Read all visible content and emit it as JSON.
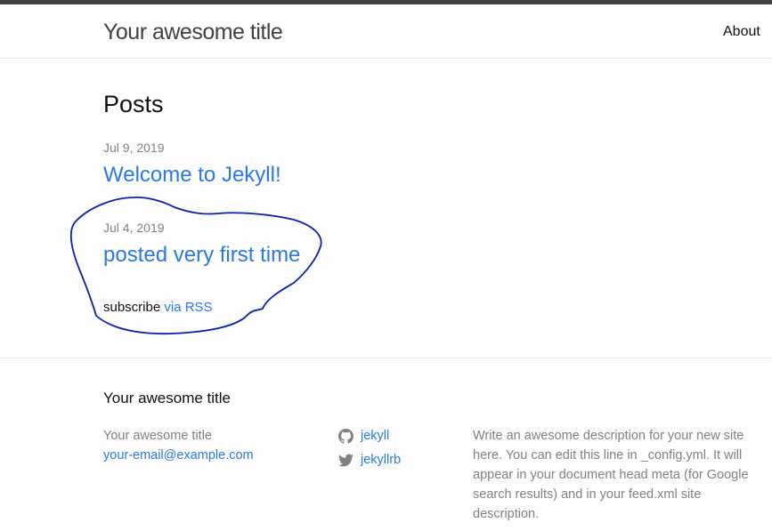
{
  "header": {
    "site_title": "Your awesome title",
    "nav": [
      {
        "label": "About"
      }
    ]
  },
  "main": {
    "heading": "Posts",
    "posts": [
      {
        "date": "Jul 9, 2019",
        "title": "Welcome to Jekyll!"
      },
      {
        "date": "Jul 4, 2019",
        "title": "posted very first time"
      }
    ],
    "subscribe": {
      "prefix": "subscribe",
      "link_label": "via RSS"
    }
  },
  "footer": {
    "heading": "Your awesome title",
    "contact": {
      "name": "Your awesome title",
      "email": "your-email@example.com"
    },
    "social": [
      {
        "icon": "github-icon",
        "label": "jekyll"
      },
      {
        "icon": "twitter-icon",
        "label": "jekyllrb"
      }
    ],
    "description": "Write an awesome description for your new site here. You can edit this line in _config.yml. It will appear in your document head meta (for Google search results) and in your feed.xml site description."
  },
  "colors": {
    "link": "#2a7ae2",
    "muted": "#828282",
    "annotation": "#0a1fb4"
  }
}
